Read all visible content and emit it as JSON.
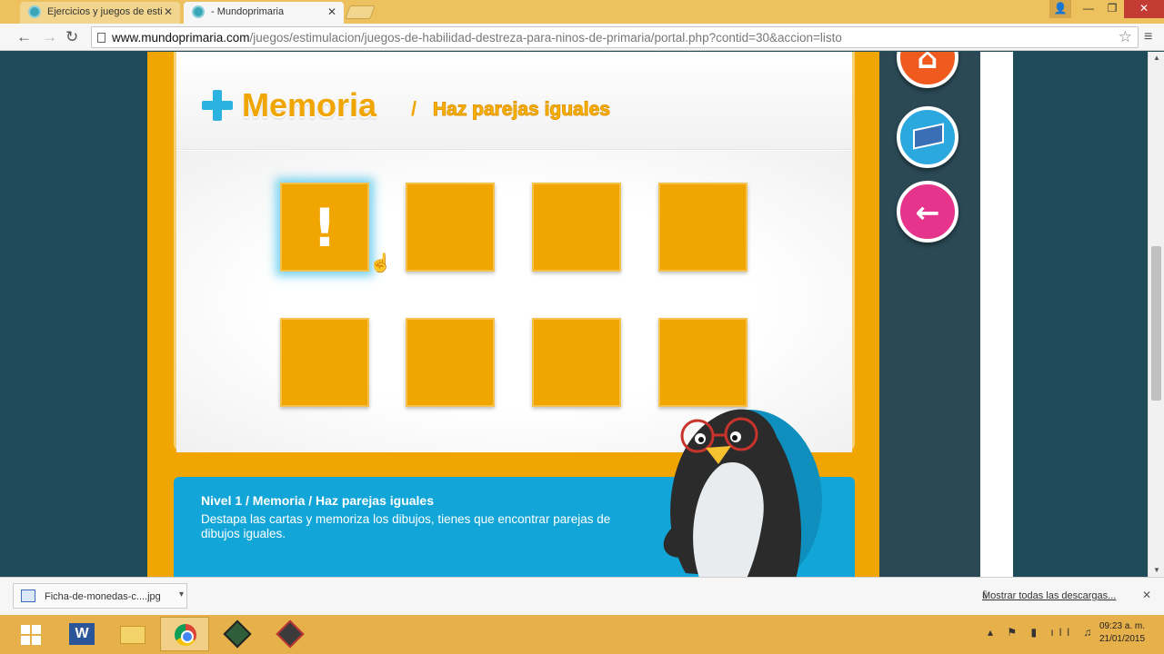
{
  "browser": {
    "tabs": [
      {
        "title": "Ejercicios y juegos de esti",
        "active": false
      },
      {
        "title": "- Mundoprimaria",
        "active": true
      }
    ],
    "url_host": "www.mundoprimaria.com",
    "url_path": "/juegos/estimulacion/juegos-de-habilidad-destreza-para-ninos-de-primaria/portal.php?contid=30&accion=listo"
  },
  "game": {
    "title": "Memoria",
    "separator": "/",
    "subtitle": "Haz parejas iguales",
    "active_tile_symbol": "!",
    "tile_count": 8
  },
  "info": {
    "title": "Nivel 1 / Memoria / Haz parejas iguales",
    "text": "Destapa las cartas y memoriza los dibujos, tienes que encontrar parejas de dibujos iguales."
  },
  "downloads": {
    "file": "Ficha-de-monedas-c....jpg",
    "show_all": "Mostrar todas las descargas..."
  },
  "taskbar": {
    "time": "09:23 a. m.",
    "date": "21/01/2015"
  },
  "colors": {
    "accent_orange": "#f0a500",
    "accent_blue": "#12a6d8",
    "page_bg": "#1e4b57"
  }
}
